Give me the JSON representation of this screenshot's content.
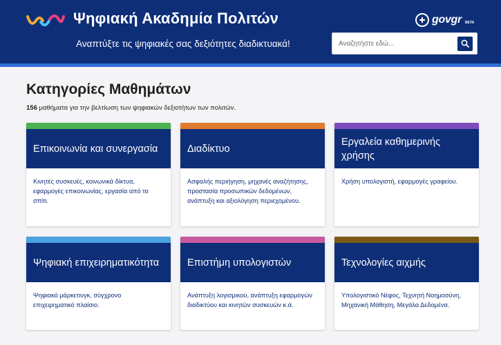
{
  "header": {
    "title": "Ψηφιακή Ακαδημία Πολιτών",
    "tagline": "Αναπτύξτε τις ψηφιακές σας δεξιότητες διαδικτυακά!",
    "gov_logo_text": "govgr",
    "gov_logo_badge": "BETA",
    "logo_colors": [
      "#f0a93b",
      "#4fc3f7",
      "#ec407a"
    ]
  },
  "search": {
    "placeholder": "Αναζητήστε εδώ..."
  },
  "main": {
    "title": "Κατηγορίες Μαθημάτων",
    "course_count": "156",
    "subtitle_rest": " μαθήματα για την βελτίωση των ψηφιακών δεξιοτήτων των πολιτών."
  },
  "categories": [
    {
      "title": "Επικοινωνία και συνεργασία",
      "description": "Κινητές συσκευές, κοινωνικά δίκτυα, εφαρμογές επικοινωνίας, εργασία από το σπίτι.",
      "color": "#4caf50"
    },
    {
      "title": "Διαδίκτυο",
      "description": "Ασφαλής περιήγηση, μηχανές αναζήτησης, προστασία προσωπικών δεδομένων, ανάπτυξη και αξιολόγηση περιεχομένου.",
      "color": "#e07b2f"
    },
    {
      "title": "Εργαλεία καθημερινής χρήσης",
      "description": "Χρήση υπολογιστή, εφαρμογές γραφείου.",
      "color": "#7c4dbd"
    },
    {
      "title": "Ψηφιακή επιχειρηματικότητα",
      "description": "Ψηφιακό μάρκετινγκ, σύγχρονο επιχειρηματικό πλαίσιο.",
      "color": "#4aa3df"
    },
    {
      "title": "Επιστήμη υπολογιστών",
      "description": "Ανάπτυξη λογισμικού, ανάπτυξη εφαρμογών διαδικτύου και κινητών συσκευών κ.ά.",
      "color": "#c95aa0"
    },
    {
      "title": "Τεχνολογίες αιχμής",
      "description": "Υπολογιστικό Νέφος, Τεχνητή Νοημοσύνη, Μηχανική Μάθηση, Μεγάλα Δεδομένα.",
      "color": "#7a5a16"
    }
  ]
}
